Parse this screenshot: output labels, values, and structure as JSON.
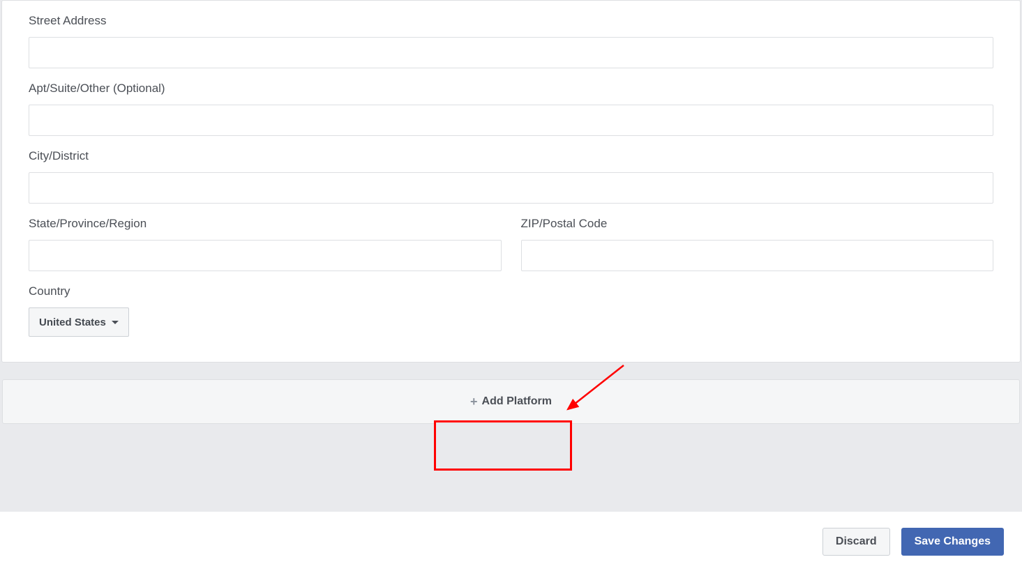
{
  "form": {
    "street_address": {
      "label": "Street Address",
      "value": ""
    },
    "apt": {
      "label": "Apt/Suite/Other (Optional)",
      "value": ""
    },
    "city": {
      "label": "City/District",
      "value": ""
    },
    "state": {
      "label": "State/Province/Region",
      "value": ""
    },
    "zip": {
      "label": "ZIP/Postal Code",
      "value": ""
    },
    "country": {
      "label": "Country",
      "selected": "United States"
    }
  },
  "add_platform": {
    "label": "Add Platform"
  },
  "footer": {
    "discard": "Discard",
    "save": "Save Changes"
  }
}
